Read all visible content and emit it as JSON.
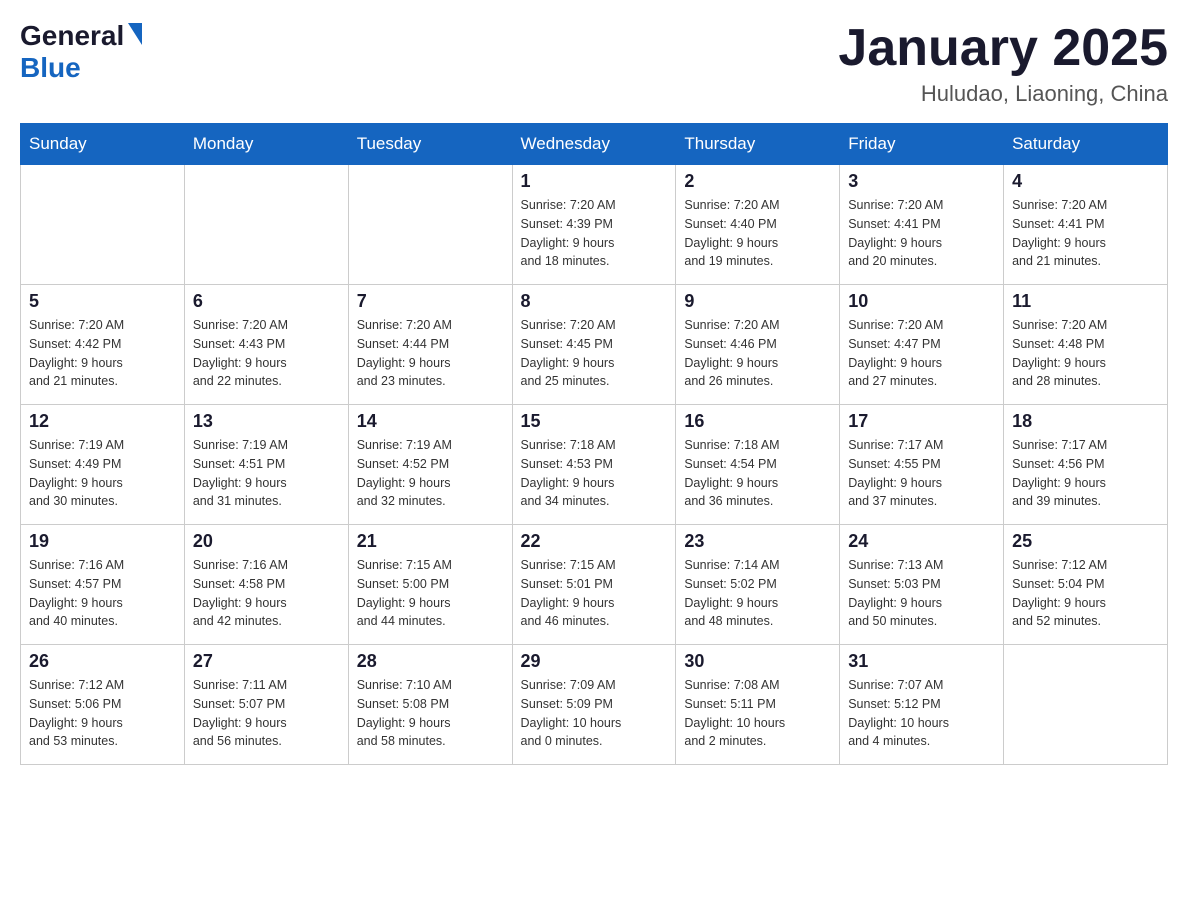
{
  "header": {
    "logo": {
      "general": "General",
      "blue": "Blue"
    },
    "title": "January 2025",
    "subtitle": "Huludao, Liaoning, China"
  },
  "calendar": {
    "days_of_week": [
      "Sunday",
      "Monday",
      "Tuesday",
      "Wednesday",
      "Thursday",
      "Friday",
      "Saturday"
    ],
    "weeks": [
      [
        {
          "day": "",
          "info": ""
        },
        {
          "day": "",
          "info": ""
        },
        {
          "day": "",
          "info": ""
        },
        {
          "day": "1",
          "info": "Sunrise: 7:20 AM\nSunset: 4:39 PM\nDaylight: 9 hours\nand 18 minutes."
        },
        {
          "day": "2",
          "info": "Sunrise: 7:20 AM\nSunset: 4:40 PM\nDaylight: 9 hours\nand 19 minutes."
        },
        {
          "day": "3",
          "info": "Sunrise: 7:20 AM\nSunset: 4:41 PM\nDaylight: 9 hours\nand 20 minutes."
        },
        {
          "day": "4",
          "info": "Sunrise: 7:20 AM\nSunset: 4:41 PM\nDaylight: 9 hours\nand 21 minutes."
        }
      ],
      [
        {
          "day": "5",
          "info": "Sunrise: 7:20 AM\nSunset: 4:42 PM\nDaylight: 9 hours\nand 21 minutes."
        },
        {
          "day": "6",
          "info": "Sunrise: 7:20 AM\nSunset: 4:43 PM\nDaylight: 9 hours\nand 22 minutes."
        },
        {
          "day": "7",
          "info": "Sunrise: 7:20 AM\nSunset: 4:44 PM\nDaylight: 9 hours\nand 23 minutes."
        },
        {
          "day": "8",
          "info": "Sunrise: 7:20 AM\nSunset: 4:45 PM\nDaylight: 9 hours\nand 25 minutes."
        },
        {
          "day": "9",
          "info": "Sunrise: 7:20 AM\nSunset: 4:46 PM\nDaylight: 9 hours\nand 26 minutes."
        },
        {
          "day": "10",
          "info": "Sunrise: 7:20 AM\nSunset: 4:47 PM\nDaylight: 9 hours\nand 27 minutes."
        },
        {
          "day": "11",
          "info": "Sunrise: 7:20 AM\nSunset: 4:48 PM\nDaylight: 9 hours\nand 28 minutes."
        }
      ],
      [
        {
          "day": "12",
          "info": "Sunrise: 7:19 AM\nSunset: 4:49 PM\nDaylight: 9 hours\nand 30 minutes."
        },
        {
          "day": "13",
          "info": "Sunrise: 7:19 AM\nSunset: 4:51 PM\nDaylight: 9 hours\nand 31 minutes."
        },
        {
          "day": "14",
          "info": "Sunrise: 7:19 AM\nSunset: 4:52 PM\nDaylight: 9 hours\nand 32 minutes."
        },
        {
          "day": "15",
          "info": "Sunrise: 7:18 AM\nSunset: 4:53 PM\nDaylight: 9 hours\nand 34 minutes."
        },
        {
          "day": "16",
          "info": "Sunrise: 7:18 AM\nSunset: 4:54 PM\nDaylight: 9 hours\nand 36 minutes."
        },
        {
          "day": "17",
          "info": "Sunrise: 7:17 AM\nSunset: 4:55 PM\nDaylight: 9 hours\nand 37 minutes."
        },
        {
          "day": "18",
          "info": "Sunrise: 7:17 AM\nSunset: 4:56 PM\nDaylight: 9 hours\nand 39 minutes."
        }
      ],
      [
        {
          "day": "19",
          "info": "Sunrise: 7:16 AM\nSunset: 4:57 PM\nDaylight: 9 hours\nand 40 minutes."
        },
        {
          "day": "20",
          "info": "Sunrise: 7:16 AM\nSunset: 4:58 PM\nDaylight: 9 hours\nand 42 minutes."
        },
        {
          "day": "21",
          "info": "Sunrise: 7:15 AM\nSunset: 5:00 PM\nDaylight: 9 hours\nand 44 minutes."
        },
        {
          "day": "22",
          "info": "Sunrise: 7:15 AM\nSunset: 5:01 PM\nDaylight: 9 hours\nand 46 minutes."
        },
        {
          "day": "23",
          "info": "Sunrise: 7:14 AM\nSunset: 5:02 PM\nDaylight: 9 hours\nand 48 minutes."
        },
        {
          "day": "24",
          "info": "Sunrise: 7:13 AM\nSunset: 5:03 PM\nDaylight: 9 hours\nand 50 minutes."
        },
        {
          "day": "25",
          "info": "Sunrise: 7:12 AM\nSunset: 5:04 PM\nDaylight: 9 hours\nand 52 minutes."
        }
      ],
      [
        {
          "day": "26",
          "info": "Sunrise: 7:12 AM\nSunset: 5:06 PM\nDaylight: 9 hours\nand 53 minutes."
        },
        {
          "day": "27",
          "info": "Sunrise: 7:11 AM\nSunset: 5:07 PM\nDaylight: 9 hours\nand 56 minutes."
        },
        {
          "day": "28",
          "info": "Sunrise: 7:10 AM\nSunset: 5:08 PM\nDaylight: 9 hours\nand 58 minutes."
        },
        {
          "day": "29",
          "info": "Sunrise: 7:09 AM\nSunset: 5:09 PM\nDaylight: 10 hours\nand 0 minutes."
        },
        {
          "day": "30",
          "info": "Sunrise: 7:08 AM\nSunset: 5:11 PM\nDaylight: 10 hours\nand 2 minutes."
        },
        {
          "day": "31",
          "info": "Sunrise: 7:07 AM\nSunset: 5:12 PM\nDaylight: 10 hours\nand 4 minutes."
        },
        {
          "day": "",
          "info": ""
        }
      ]
    ]
  }
}
